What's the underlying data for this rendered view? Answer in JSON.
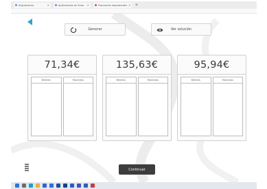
{
  "browser": {
    "tabs": [
      {
        "label": "Seguimiento"
      },
      {
        "label": "Aplicaciones en línea"
      },
      {
        "label": "Fracciones equivalentes"
      }
    ],
    "new_tab": "+"
  },
  "toolbar": {
    "generate_label": "Generar",
    "solution_label": "Ver solución"
  },
  "cards": [
    {
      "amount": "71,34€",
      "col_left": "Billetes",
      "col_right": "Monedas"
    },
    {
      "amount": "135,63€",
      "col_left": "Billetes",
      "col_right": "Monedas"
    },
    {
      "amount": "95,94€",
      "col_left": "Billetes",
      "col_right": "Monedas"
    }
  ],
  "continue_label": "Continuar",
  "colors": {
    "accent": "#2aa7c8",
    "continue_bg": "#3d3d3d",
    "card_border": "#cfcfcf"
  },
  "icons": {
    "back": "back-arrow-icon",
    "generate": "refresh-circle-icon",
    "solution": "eye-icon"
  },
  "taskbar": {
    "apps": [
      "windows",
      "search",
      "edge",
      "files",
      "store",
      "mail",
      "calendar",
      "photos",
      "settings",
      "teams",
      "word",
      "excel"
    ]
  }
}
